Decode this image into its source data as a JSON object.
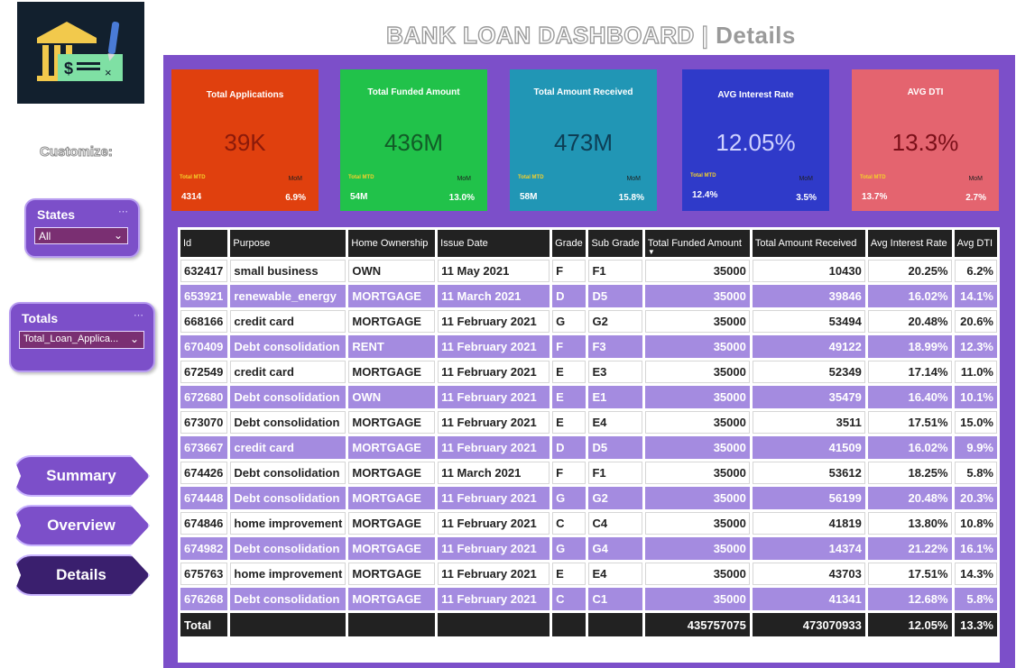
{
  "header": {
    "title": "BANK LOAN DASHBOARD",
    "separator": "|",
    "subtitle": "Details"
  },
  "sidebar": {
    "customize_label": "Customize:",
    "states": {
      "label": "States",
      "value": "All"
    },
    "totals": {
      "label": "Totals",
      "value": "Total_Loan_Applica..."
    },
    "nav": [
      {
        "label": "Summary"
      },
      {
        "label": "Overview"
      },
      {
        "label": "Details"
      }
    ]
  },
  "kpis": [
    {
      "title": "Total Applications",
      "value": "39K",
      "mtd_label": "Total MTD",
      "mtd": "4314",
      "mom_label": "MoM",
      "mom": "6.9%",
      "color": "#e0400e",
      "value_color": "#8b1a0a"
    },
    {
      "title": "Total Funded Amount",
      "value": "436M",
      "mtd_label": "Total MTD",
      "mtd": "54M",
      "mom_label": "MoM",
      "mom": "13.0%",
      "color": "#21c24a",
      "value_color": "#125b27"
    },
    {
      "title": "Total Amount Received",
      "value": "473M",
      "mtd_label": "Total MTD",
      "mtd": "58M",
      "mom_label": "MoM",
      "mom": "15.8%",
      "color": "#2196b5",
      "value_color": "#0d3e55"
    },
    {
      "title": "AVG Interest Rate",
      "value": "12.05%",
      "mtd_label": "Total MTD",
      "mtd": "12.4%",
      "mom_label": "MoM",
      "mom": "3.5%",
      "color": "#2f3ac9",
      "value_color": "#cfd2ff"
    },
    {
      "title": "AVG DTI",
      "value": "13.3%",
      "mtd_label": "Total MTD",
      "mtd": "13.7%",
      "mom_label": "MoM",
      "mom": "2.7%",
      "color": "#e4646f",
      "value_color": "#7a0f18"
    }
  ],
  "table": {
    "columns": [
      "Id",
      "Purpose",
      "Home Ownership",
      "Issue Date",
      "Grade",
      "Sub Grade",
      "Total Funded Amount",
      "Total Amount Received",
      "Avg Interest Rate",
      "Avg DTI"
    ],
    "rows": [
      [
        "632417",
        "small business",
        "OWN",
        "11 May 2021",
        "F",
        "F1",
        "35000",
        "10430",
        "20.25%",
        "6.2%"
      ],
      [
        "653921",
        "renewable_energy",
        "MORTGAGE",
        "11 March 2021",
        "D",
        "D5",
        "35000",
        "39846",
        "16.02%",
        "14.1%"
      ],
      [
        "668166",
        "credit card",
        "MORTGAGE",
        "11 February 2021",
        "G",
        "G2",
        "35000",
        "53494",
        "20.48%",
        "20.6%"
      ],
      [
        "670409",
        "Debt consolidation",
        "RENT",
        "11 February 2021",
        "F",
        "F3",
        "35000",
        "49122",
        "18.99%",
        "12.3%"
      ],
      [
        "672549",
        "credit card",
        "MORTGAGE",
        "11 February 2021",
        "E",
        "E3",
        "35000",
        "52349",
        "17.14%",
        "11.0%"
      ],
      [
        "672680",
        "Debt consolidation",
        "OWN",
        "11 February 2021",
        "E",
        "E1",
        "35000",
        "35479",
        "16.40%",
        "10.1%"
      ],
      [
        "673070",
        "Debt consolidation",
        "MORTGAGE",
        "11 February 2021",
        "E",
        "E4",
        "35000",
        "3511",
        "17.51%",
        "15.0%"
      ],
      [
        "673667",
        "credit card",
        "MORTGAGE",
        "11 February 2021",
        "D",
        "D5",
        "35000",
        "41509",
        "16.02%",
        "9.9%"
      ],
      [
        "674426",
        "Debt consolidation",
        "MORTGAGE",
        "11 March 2021",
        "F",
        "F1",
        "35000",
        "53612",
        "18.25%",
        "5.8%"
      ],
      [
        "674448",
        "Debt consolidation",
        "MORTGAGE",
        "11 February 2021",
        "G",
        "G2",
        "35000",
        "56199",
        "20.48%",
        "20.3%"
      ],
      [
        "674846",
        "home improvement",
        "MORTGAGE",
        "11 February 2021",
        "C",
        "C4",
        "35000",
        "41819",
        "13.80%",
        "10.8%"
      ],
      [
        "674982",
        "Debt consolidation",
        "MORTGAGE",
        "11 February 2021",
        "G",
        "G4",
        "35000",
        "14374",
        "21.22%",
        "16.1%"
      ],
      [
        "675763",
        "home improvement",
        "MORTGAGE",
        "11 February 2021",
        "E",
        "E4",
        "35000",
        "43703",
        "17.51%",
        "14.3%"
      ],
      [
        "676268",
        "Debt consolidation",
        "MORTGAGE",
        "11 February 2021",
        "C",
        "C1",
        "35000",
        "41341",
        "12.68%",
        "5.8%"
      ]
    ],
    "total": [
      "Total",
      "",
      "",
      "",
      "",
      "",
      "435757075",
      "473070933",
      "12.05%",
      "13.3%"
    ]
  }
}
